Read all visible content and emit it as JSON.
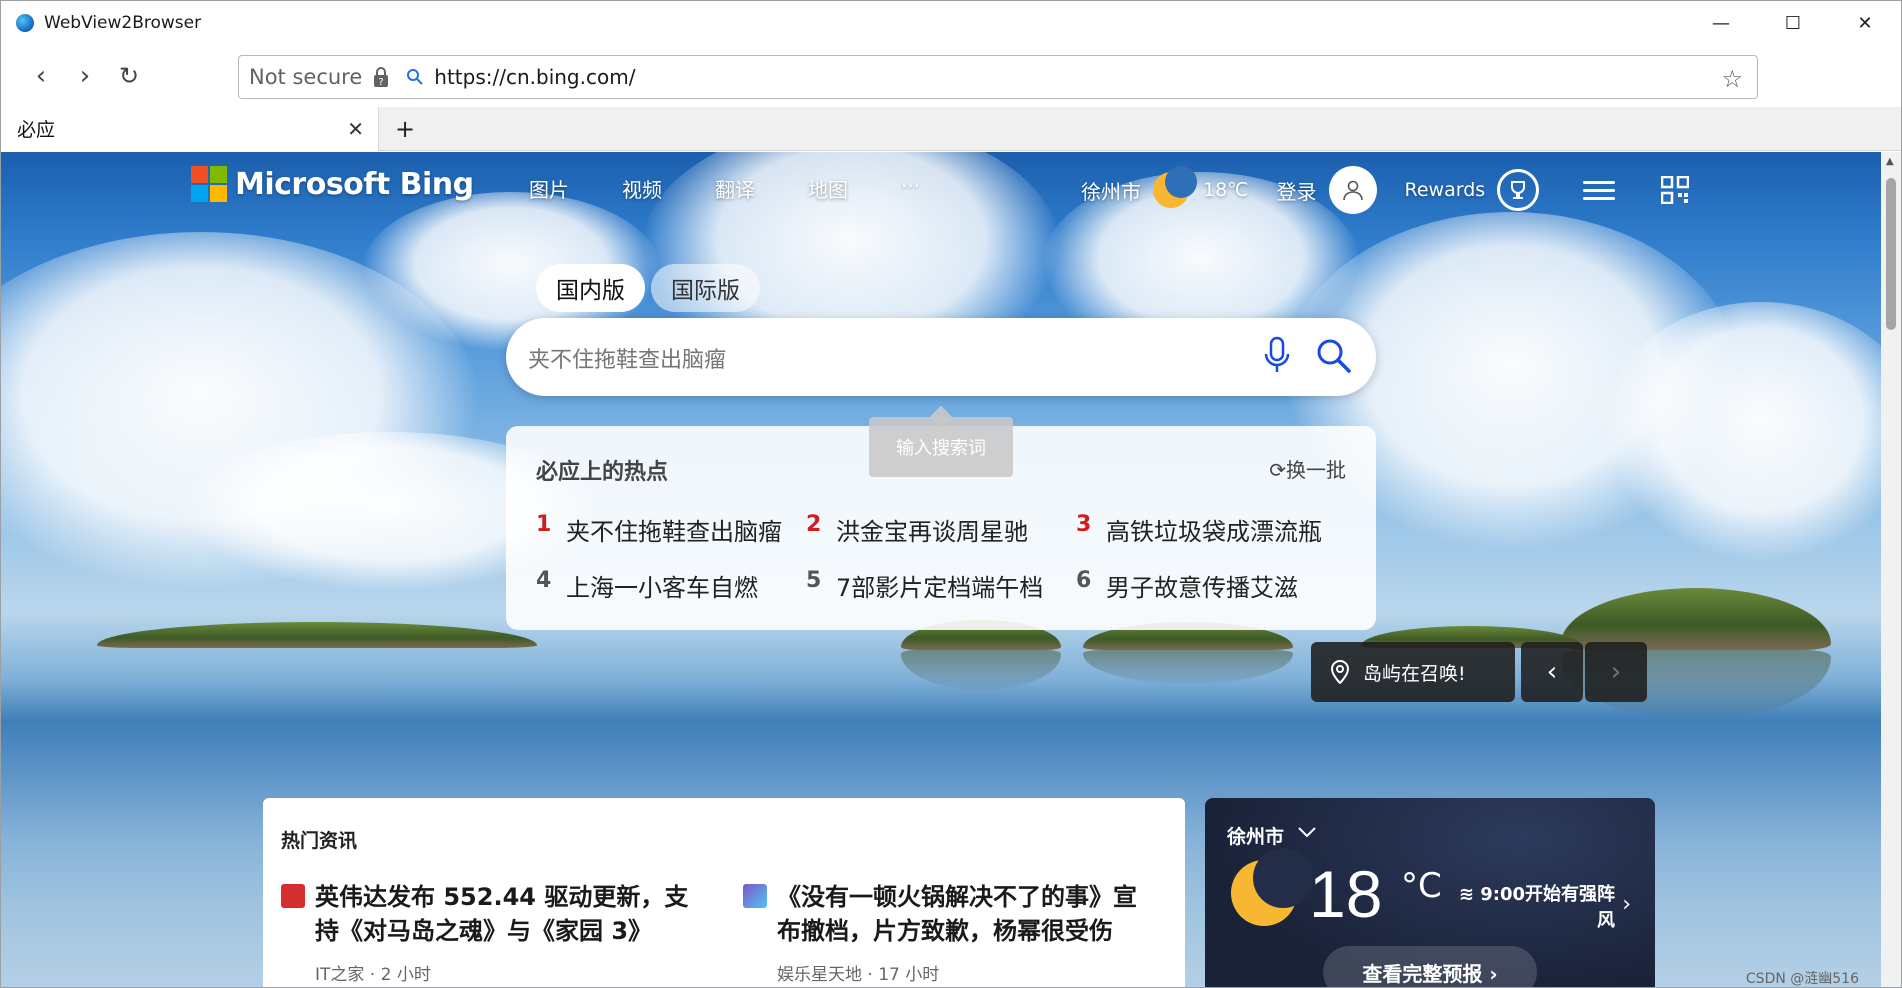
{
  "window": {
    "title": "WebView2Browser",
    "minimize_glyph": "—",
    "maximize_glyph": "☐",
    "close_glyph": "✕"
  },
  "navbar": {
    "back_glyph": "‹",
    "forward_glyph": "›",
    "reload_glyph": "↻",
    "security_label": "Not secure",
    "url": "https://cn.bing.com/",
    "favorite_glyph": "☆",
    "more_glyph": "···"
  },
  "tabs": {
    "items": [
      {
        "label": "必应",
        "close_glyph": "✕"
      }
    ],
    "add_glyph": "+"
  },
  "bing": {
    "logo_text": "Microsoft Bing",
    "logo_colors": [
      "#f25022",
      "#7fba00",
      "#00a4ef",
      "#ffb900"
    ],
    "nav": [
      "图片",
      "视频",
      "翻译",
      "地图",
      "···"
    ],
    "city": "徐州市",
    "temp_small": "18℃",
    "login_label": "登录",
    "rewards_label": "Rewards",
    "scope_tabs": [
      "国内版",
      "国际版"
    ],
    "search_placeholder": "夹不住拖鞋查出脑瘤",
    "tooltip": "输入搜索词",
    "trending": {
      "title": "必应上的热点",
      "refresh_label": "换一批",
      "items": [
        {
          "rank": "1",
          "text": "夹不住拖鞋查出脑瘤",
          "hot": true
        },
        {
          "rank": "2",
          "text": "洪金宝再谈周星驰",
          "hot": true
        },
        {
          "rank": "3",
          "text": "高铁垃圾袋成漂流瓶",
          "hot": true
        },
        {
          "rank": "4",
          "text": "上海一小客车自燃",
          "hot": false
        },
        {
          "rank": "5",
          "text": "7部影片定档端午档",
          "hot": false
        },
        {
          "rank": "6",
          "text": "男子故意传播艾滋",
          "hot": false
        }
      ]
    },
    "caption": "岛屿在召唤!",
    "prev_glyph": "‹",
    "next_glyph": "›"
  },
  "news": {
    "title": "热门资讯",
    "items": [
      {
        "headline": "英伟达发布 552.44 驱动更新，支持《对马岛之魂》与《家园 3》",
        "source": "IT之家",
        "time": "2 小时",
        "icon_color": "#d32f2f"
      },
      {
        "headline": "《没有一顿火锅解决不了的事》宣布撤档，片方致歉，杨幂很受伤",
        "source": "娱乐星天地",
        "time": "17 小时",
        "icon_color": "#7e57c2"
      }
    ]
  },
  "weather": {
    "city": "徐州市",
    "temp": "18",
    "unit": "°C",
    "wind_text": "9:00开始有强阵风",
    "forecast_label": "查看完整预报 ›"
  },
  "watermark": "CSDN @涟幽516"
}
